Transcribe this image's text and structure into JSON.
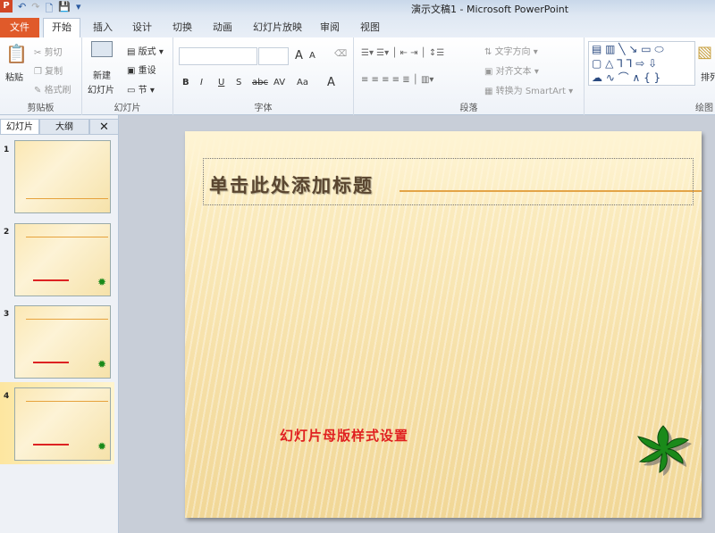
{
  "window": {
    "title": "演示文稿1  -  Microsoft PowerPoint",
    "app_icon": "P"
  },
  "quick_access": {
    "undo": "↶",
    "redo": "↷",
    "new": "🗋",
    "save": "💾",
    "customize": "▾"
  },
  "tabs": [
    "文件",
    "开始",
    "插入",
    "设计",
    "切换",
    "动画",
    "幻灯片放映",
    "审阅",
    "视图"
  ],
  "ribbon": {
    "clipboard": {
      "label": "剪贴板",
      "paste": "粘贴",
      "cut": "剪切",
      "copy": "复制",
      "format_painter": "格式刷"
    },
    "slides": {
      "label": "幻灯片",
      "new_slide_1": "新建",
      "new_slide_2": "幻灯片",
      "layout": "版式",
      "reset": "重设",
      "section": "节"
    },
    "font": {
      "label": "字体",
      "font_name": "",
      "font_size": "",
      "bold": "B",
      "italic": "I",
      "underline": "U",
      "shadow": "S",
      "strike": "abc",
      "spacing": "AV",
      "case": "Aa",
      "grow": "A",
      "shrink": "A",
      "color": "A"
    },
    "paragraph": {
      "label": "段落",
      "text_direction": "文字方向",
      "align_text": "对齐文本",
      "smartart": "转换为 SmartArt"
    },
    "drawing": {
      "label": "绘图",
      "arrange": "排列"
    }
  },
  "left_panel": {
    "tabs": [
      "幻灯片",
      "大纲"
    ],
    "close": "✕",
    "slides": [
      {
        "num": "1"
      },
      {
        "num": "2"
      },
      {
        "num": "3"
      },
      {
        "num": "4"
      }
    ],
    "selected": 4
  },
  "slide": {
    "title_placeholder": "单击此处添加标题",
    "subtitle": "幻灯片母版样式设置"
  },
  "colors": {
    "file_tab": "#e05a2a",
    "subtitle": "#e02020",
    "title": "#5a4630",
    "leaf": "#1a8a1a",
    "accent_line": "#e3a447"
  }
}
